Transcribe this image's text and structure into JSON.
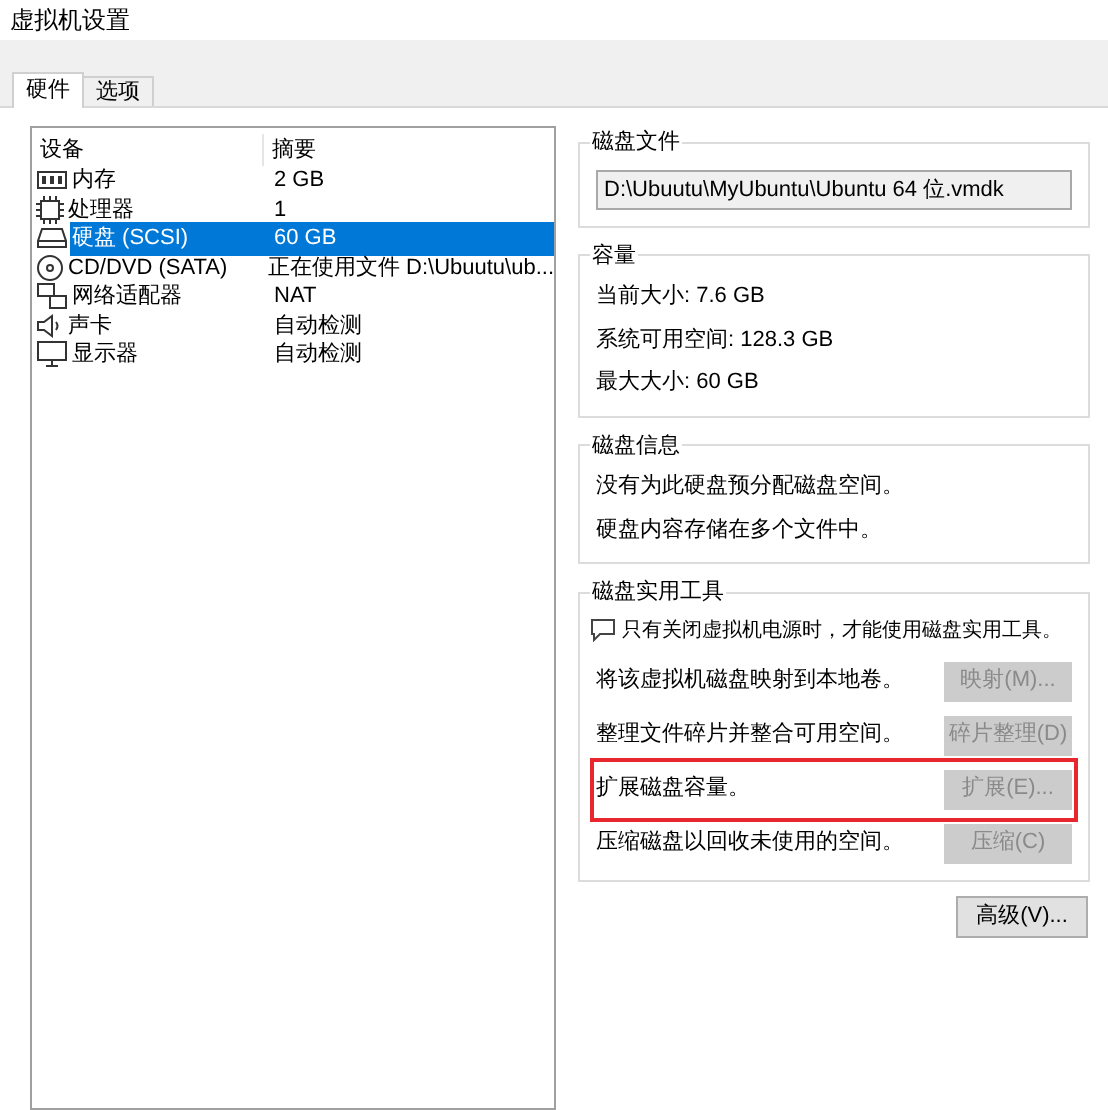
{
  "window": {
    "title": "虚拟机设置"
  },
  "tabs": [
    {
      "label": "硬件",
      "selected": true
    },
    {
      "label": "选项",
      "selected": false
    }
  ],
  "device_list": {
    "columns": [
      "设备",
      "摘要"
    ],
    "rows": [
      {
        "kind": "memory",
        "device": "内存",
        "summary": "2 GB",
        "selected": false
      },
      {
        "kind": "cpu",
        "device": "处理器",
        "summary": "1",
        "selected": false
      },
      {
        "kind": "disk",
        "device": "硬盘 (SCSI)",
        "summary": "60 GB",
        "selected": true
      },
      {
        "kind": "cd",
        "device": "CD/DVD (SATA)",
        "summary": "正在使用文件 D:\\Ubuutu\\ub...",
        "selected": false
      },
      {
        "kind": "network",
        "device": "网络适配器",
        "summary": "NAT",
        "selected": false
      },
      {
        "kind": "sound",
        "device": "声卡",
        "summary": "自动检测",
        "selected": false
      },
      {
        "kind": "display",
        "device": "显示器",
        "summary": "自动检测",
        "selected": false
      }
    ]
  },
  "disk_file": {
    "title": "磁盘文件",
    "value": "D:\\Ubuutu\\MyUbuntu\\Ubuntu 64 位.vmdk"
  },
  "capacity": {
    "title": "容量",
    "lines": [
      "当前大小: 7.6 GB",
      "系统可用空间: 128.3 GB",
      "最大大小: 60 GB"
    ]
  },
  "disk_info": {
    "title": "磁盘信息",
    "lines": [
      "没有为此硬盘预分配磁盘空间。",
      "硬盘内容存储在多个文件中。"
    ]
  },
  "disk_utilities": {
    "title": "磁盘实用工具",
    "note": "只有关闭虚拟机电源时，才能使用磁盘实用工具。",
    "actions": [
      {
        "description": "将该虚拟机磁盘映射到本地卷。",
        "button": "映射(M)...",
        "disabled": true,
        "highlighted": false
      },
      {
        "description": "整理文件碎片并整合可用空间。",
        "button": "碎片整理(D)",
        "disabled": true,
        "highlighted": false
      },
      {
        "description": "扩展磁盘容量。",
        "button": "扩展(E)...",
        "disabled": true,
        "highlighted": true
      },
      {
        "description": "压缩磁盘以回收未使用的空间。",
        "button": "压缩(C)",
        "disabled": true,
        "highlighted": false
      }
    ]
  },
  "advanced_button": {
    "label": "高级(V)...",
    "disabled": false
  }
}
